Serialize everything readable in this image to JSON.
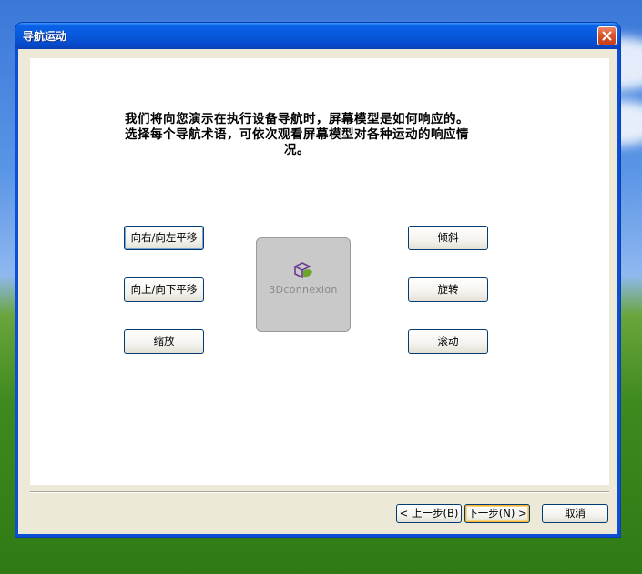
{
  "window": {
    "title": "导航运动"
  },
  "intro_text": "我们将向您演示在执行设备导航时，屏幕模型是如何响应的。选择每个导航术语，可依次观看屏幕模型对各种运动的响应情况。",
  "left_buttons": [
    {
      "label": "向右/向左平移"
    },
    {
      "label": "向上/向下平移"
    },
    {
      "label": "缩放"
    }
  ],
  "right_buttons": [
    {
      "label": "倾斜"
    },
    {
      "label": "旋转"
    },
    {
      "label": "滚动"
    }
  ],
  "logo": {
    "text": "3Dconnexion",
    "icon": "3dconnexion-cube-icon"
  },
  "footer": {
    "back_label": "< 上一步(B)",
    "next_label": "下一步(N) >",
    "cancel_label": "取消"
  },
  "colors": {
    "title_bar": "#0858dc",
    "dialog_bg": "#ece9d8",
    "panel_bg": "#ffffff",
    "button_border": "#003c74",
    "default_button_highlight": "#f8b63c",
    "close_button": "#d8542c"
  }
}
